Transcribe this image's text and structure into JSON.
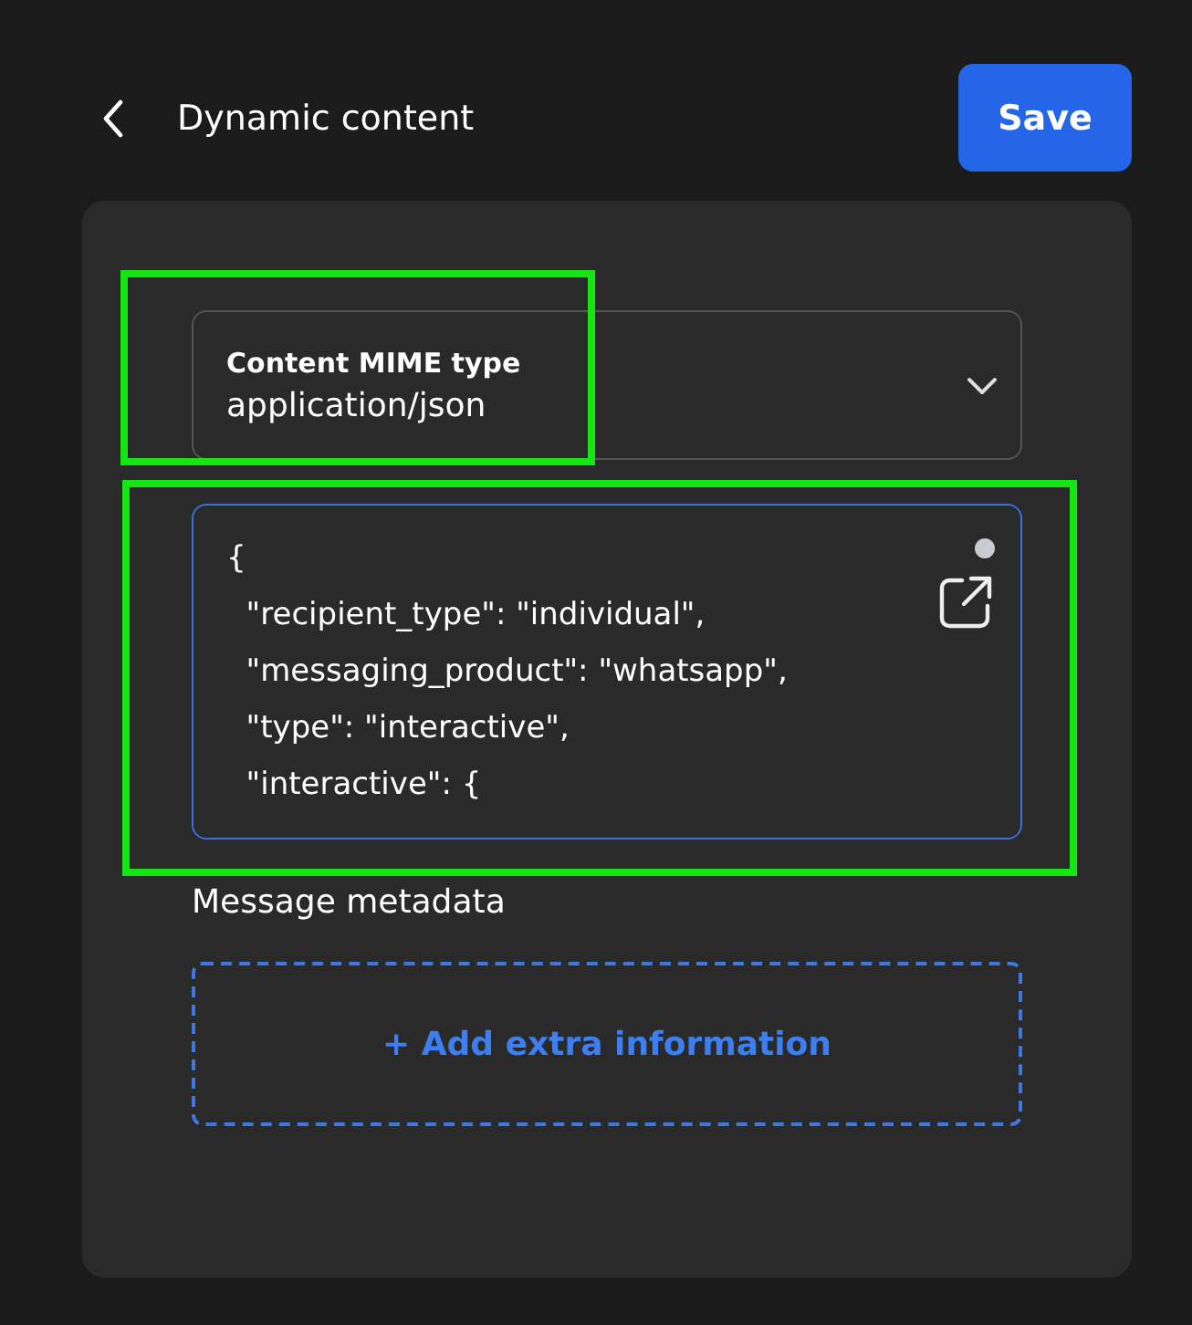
{
  "header": {
    "title": "Dynamic content",
    "save_button": "Save"
  },
  "mime_select": {
    "label": "Content MIME type",
    "value": "application/json"
  },
  "editor": {
    "lines": [
      "{",
      "  \"recipient_type\": \"individual\",",
      "  \"messaging_product\": \"whatsapp\",",
      "  \"type\": \"interactive\",",
      "  \"interactive\": {"
    ],
    "modified": true
  },
  "metadata": {
    "label": "Message metadata",
    "add_button": "+ Add extra information"
  }
}
